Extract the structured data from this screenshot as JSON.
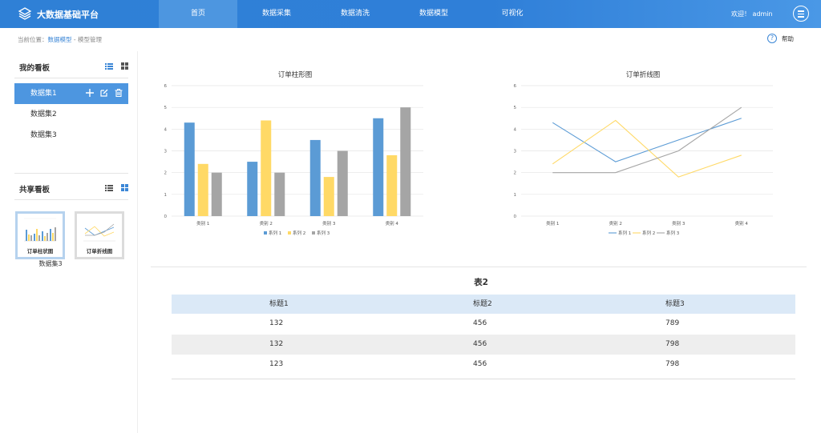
{
  "app": {
    "title": "大数据基础平台",
    "welcome": "欢迎！ admin"
  },
  "nav": [
    "首页",
    "数据采集",
    "数据清洗",
    "数据模型",
    "可视化"
  ],
  "breadcrumb": {
    "prefix": "当前位置：",
    "link": "数据模型",
    "sep": " - ",
    "current": "模型管理"
  },
  "help": {
    "icon": "?",
    "label": "帮助"
  },
  "sidebar": {
    "my_boards_title": "我的看板",
    "datasets": [
      "数据集1",
      "数据集2",
      "数据集3"
    ],
    "shared_title": "共享看板",
    "thumbs": [
      "订单柱状图",
      "订单折线图"
    ],
    "thumb_caption": "数据集3"
  },
  "colors": {
    "accent": "#4d96e0",
    "series": [
      "#5b9bd5",
      "#ffd966",
      "#a5a5a5"
    ]
  },
  "chart_data": [
    {
      "type": "bar",
      "title": "订单柱形图",
      "categories": [
        "类别 1",
        "类别 2",
        "类别 3",
        "类别 4"
      ],
      "series": [
        {
          "name": "系列 1",
          "values": [
            4.3,
            2.5,
            3.5,
            4.5
          ]
        },
        {
          "name": "系列 2",
          "values": [
            2.4,
            4.4,
            1.8,
            2.8
          ]
        },
        {
          "name": "系列 3",
          "values": [
            2,
            2,
            3,
            5
          ]
        }
      ],
      "yticks": [
        "0",
        "1",
        "2",
        "3",
        "4",
        "5",
        "6"
      ],
      "ylim": [
        0,
        6
      ],
      "legend": "bottom"
    },
    {
      "type": "line",
      "title": "订单折线图",
      "categories": [
        "类别 1",
        "类别 2",
        "类别 3",
        "类别 4"
      ],
      "series": [
        {
          "name": "系列 1",
          "values": [
            4.3,
            2.5,
            3.5,
            4.5
          ]
        },
        {
          "name": "系列 2",
          "values": [
            2.4,
            4.4,
            1.8,
            2.8
          ]
        },
        {
          "name": "系列 3",
          "values": [
            2,
            2,
            3,
            5
          ]
        }
      ],
      "yticks": [
        "0",
        "1",
        "2",
        "3",
        "4",
        "5",
        "6"
      ],
      "ylim": [
        0,
        6
      ],
      "legend": "bottom"
    }
  ],
  "table": {
    "title": "表2",
    "headers": [
      "标题1",
      "标题2",
      "标题3"
    ],
    "rows": [
      [
        "132",
        "456",
        "789"
      ],
      [
        "132",
        "456",
        "798"
      ],
      [
        "123",
        "456",
        "798"
      ]
    ]
  }
}
